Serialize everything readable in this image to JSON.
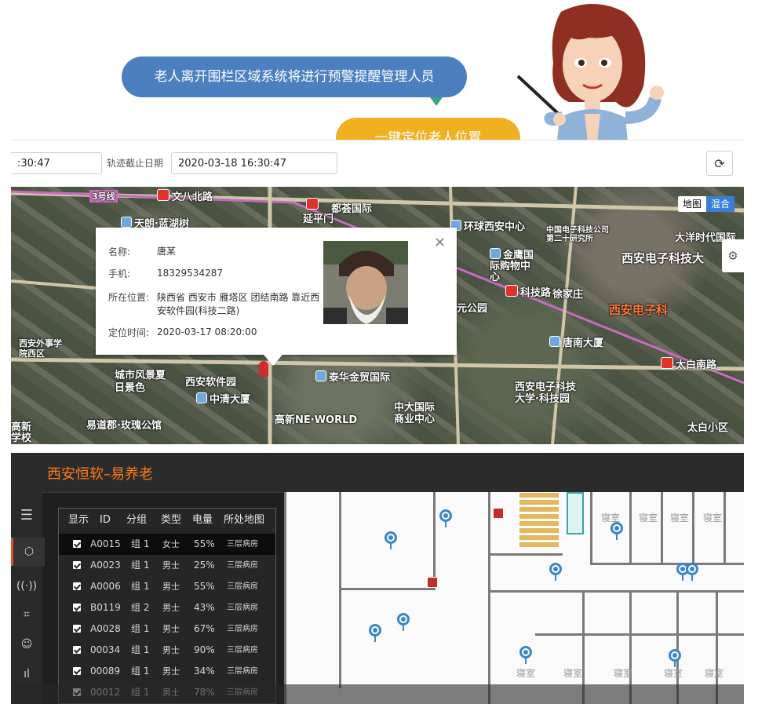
{
  "callouts": {
    "fence_warning": "老人离开围栏区域系统将进行预警提醒管理人员",
    "one_key_locate": "一键定位老人位置"
  },
  "datebar": {
    "start_value_partial": ":30:47",
    "end_label": "轨迹截止日期",
    "end_value": "2020-03-18 16:30:47",
    "refresh_icon": "refresh-icon"
  },
  "map": {
    "type_toggle": [
      "地图",
      "混合"
    ],
    "labels": [
      "3号线",
      "文八北路",
      "天朗·蓝湖树",
      "都荟国际",
      "延平门",
      "环球西安中心",
      "中国电子科技公司第二十研究所",
      "大洋时代国际",
      "西安电子科技大",
      "金鹰国际购物中心",
      "科技路",
      "徐家庄",
      "西安电子科",
      "唐南大厦",
      "太白南路",
      "西安外事学院西区",
      "城市风景夏日景色",
      "西安软件园",
      "泰华金贸国际",
      "西安电子科技大学·科技园",
      "中清大厦",
      "中大国际商业中心",
      "高新NE·WORLD",
      "易道郡·玫瑰公馆",
      "太白小区",
      "高新学校",
      "元公园"
    ]
  },
  "popup": {
    "name_label": "名称:",
    "name_value": "唐某",
    "phone_label": "手机:",
    "phone_value": "18329534287",
    "location_label": "所在位置:",
    "location_value": "陕西省 西安市 雁塔区 团结南路 靠近西安软件园(科技二路)",
    "time_label": "定位时间:",
    "time_value": "2020-03-17 08:20:00",
    "close": "×"
  },
  "app": {
    "title": "西安恒软–易养老",
    "rail": [
      "menu-icon",
      "tag-icon",
      "signal-icon",
      "fence-icon",
      "person-icon",
      "chart-icon"
    ],
    "table": {
      "headers": [
        "显示",
        "ID",
        "分组",
        "类型",
        "电量",
        "所处地图"
      ],
      "rows": [
        {
          "id": "A0015",
          "group": "组 1",
          "type": "女士",
          "battery": "55%",
          "map": "三层病房"
        },
        {
          "id": "A0023",
          "group": "组 1",
          "type": "男士",
          "battery": "25%",
          "map": "三层病房"
        },
        {
          "id": "A0006",
          "group": "组 1",
          "type": "男士",
          "battery": "55%",
          "map": "三层病房"
        },
        {
          "id": "B0119",
          "group": "组 2",
          "type": "男士",
          "battery": "43%",
          "map": "三层病房"
        },
        {
          "id": "A0028",
          "group": "组 1",
          "type": "男士",
          "battery": "67%",
          "map": "三层病房"
        },
        {
          "id": "00034",
          "group": "组 1",
          "type": "男士",
          "battery": "90%",
          "map": "三层病房"
        },
        {
          "id": "00089",
          "group": "组 1",
          "type": "男士",
          "battery": "34%",
          "map": "三层病房"
        },
        {
          "id": "00012",
          "group": "组 1",
          "type": "男士",
          "battery": "78%",
          "map": "三层病房"
        }
      ]
    },
    "rooms": [
      "寝室",
      "寝室",
      "寝室",
      "寝室",
      "寝室",
      "寝室",
      "寝室",
      "寝室",
      "寝室"
    ]
  }
}
